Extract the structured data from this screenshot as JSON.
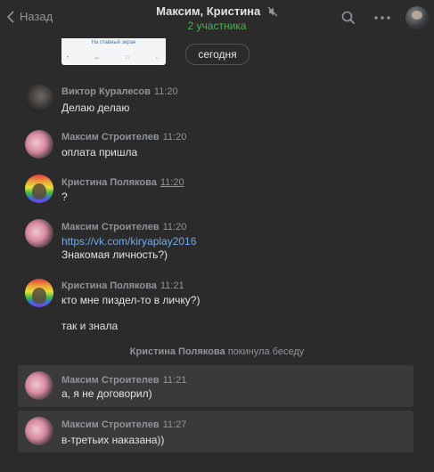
{
  "header": {
    "back_label": "Назад",
    "title": "Максим, Кристина",
    "subtitle": "2 участника"
  },
  "attachment": {
    "caption": "На главный экран",
    "nav_icons": [
      "•",
      "↩",
      "□",
      "←"
    ]
  },
  "date_badge": "сегодня",
  "messages": [
    {
      "author": "Виктор Куралесов",
      "time": "11:20",
      "lines": [
        "Делаю делаю"
      ]
    },
    {
      "author": "Максим Строителев",
      "time": "11:20",
      "lines": [
        "оплата пришла"
      ]
    },
    {
      "author": "Кристина Полякова",
      "time": "11:20",
      "lines": [
        "?"
      ]
    },
    {
      "author": "Максим Строителев",
      "time": "11:20",
      "link": "https://vk.com/kiryaplay2016",
      "lines": [
        "Знакомая личность?)"
      ]
    },
    {
      "author": "Кристина Полякова",
      "time": "11:21",
      "lines": [
        "кто мне пиздел-то в личку?)",
        "так и знала"
      ]
    },
    {
      "author": "Максим Строителев",
      "time": "11:21",
      "lines": [
        "а, я не договорил)"
      ]
    },
    {
      "author": "Максим Строителев",
      "time": "11:27",
      "lines": [
        "в-третьих наказана))"
      ]
    }
  ],
  "system_event": {
    "who": "Кристина Полякова",
    "action": "покинула беседу"
  },
  "colors": {
    "background": "#2b2b2b",
    "highlight": "#3a3a3a",
    "link": "#71aaeb",
    "online_green": "#4bb34b",
    "muted_text": "#8f949a"
  }
}
